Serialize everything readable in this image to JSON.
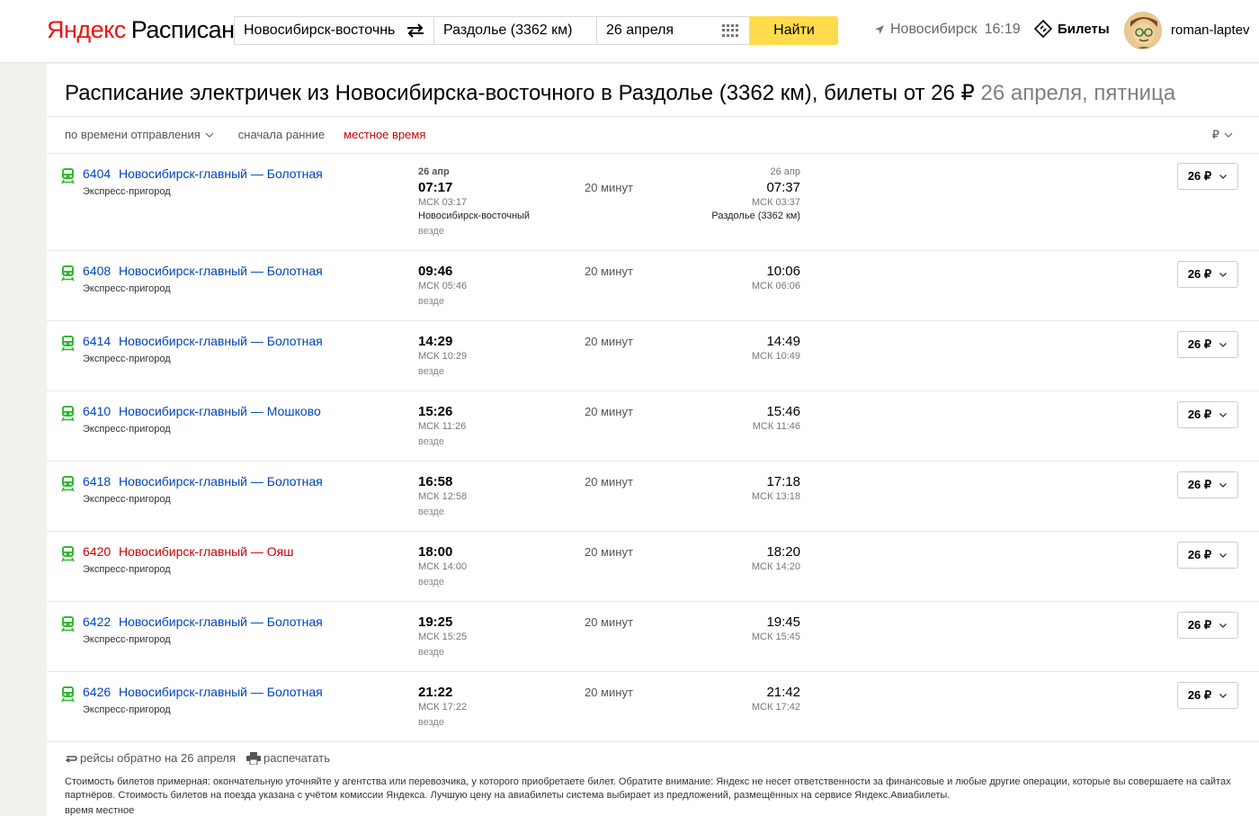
{
  "header": {
    "logo_brand": "Яндекс",
    "logo_service": "Расписания",
    "from_value": "Новосибирск-восточнь",
    "to_value": "Раздолье (3362 км)",
    "date_value": "26 апреля",
    "find_label": "Найти",
    "city": "Новосибирск",
    "local_time": "16:19",
    "tickets_label": "Билеты",
    "username": "roman-laptev"
  },
  "page": {
    "title_main": "Расписание электричек из Новосибирска-восточного в Раздолье (3362 км), билеты от 26 ₽",
    "title_date": "26 апреля, пятница"
  },
  "sort": {
    "by_departure": "по времени отправления",
    "early_first": "сначала ранние",
    "local_time": "местное время",
    "currency": "₽"
  },
  "trains": [
    {
      "number": "6404",
      "route": "Новосибирск-главный — Болотная",
      "type": "Экспресс-пригород",
      "dep_date": "26 апр",
      "dep_time": "07:17",
      "dep_msk": "МСК 03:17",
      "dep_station": "Новосибирск-восточный",
      "days": "везде",
      "duration": "20 минут",
      "arr_date": "26 апр",
      "arr_time": "07:37",
      "arr_msk": "МСК 03:37",
      "arr_station": "Раздолье (3362 км)",
      "price": "26 ₽",
      "highlight": false
    },
    {
      "number": "6408",
      "route": "Новосибирск-главный — Болотная",
      "type": "Экспресс-пригород",
      "dep_time": "09:46",
      "dep_msk": "МСК 05:46",
      "days": "везде",
      "duration": "20 минут",
      "arr_time": "10:06",
      "arr_msk": "МСК 06:06",
      "price": "26 ₽",
      "highlight": false
    },
    {
      "number": "6414",
      "route": "Новосибирск-главный — Болотная",
      "type": "Экспресс-пригород",
      "dep_time": "14:29",
      "dep_msk": "МСК 10:29",
      "days": "везде",
      "duration": "20 минут",
      "arr_time": "14:49",
      "arr_msk": "МСК 10:49",
      "price": "26 ₽",
      "highlight": false
    },
    {
      "number": "6410",
      "route": "Новосибирск-главный — Мошково",
      "type": "Экспресс-пригород",
      "dep_time": "15:26",
      "dep_msk": "МСК 11:26",
      "days": "везде",
      "duration": "20 минут",
      "arr_time": "15:46",
      "arr_msk": "МСК 11:46",
      "price": "26 ₽",
      "highlight": false
    },
    {
      "number": "6418",
      "route": "Новосибирск-главный — Болотная",
      "type": "Экспресс-пригород",
      "dep_time": "16:58",
      "dep_msk": "МСК 12:58",
      "days": "везде",
      "duration": "20 минут",
      "arr_time": "17:18",
      "arr_msk": "МСК 13:18",
      "price": "26 ₽",
      "highlight": false
    },
    {
      "number": "6420",
      "route": "Новосибирск-главный — Ояш",
      "type": "Экспресс-пригород",
      "dep_time": "18:00",
      "dep_msk": "МСК 14:00",
      "days": "везде",
      "duration": "20 минут",
      "arr_time": "18:20",
      "arr_msk": "МСК 14:20",
      "price": "26 ₽",
      "highlight": true
    },
    {
      "number": "6422",
      "route": "Новосибирск-главный — Болотная",
      "type": "Экспресс-пригород",
      "dep_time": "19:25",
      "dep_msk": "МСК 15:25",
      "days": "везде",
      "duration": "20 минут",
      "arr_time": "19:45",
      "arr_msk": "МСК 15:45",
      "price": "26 ₽",
      "highlight": false
    },
    {
      "number": "6426",
      "route": "Новосибирск-главный — Болотная",
      "type": "Экспресс-пригород",
      "dep_time": "21:22",
      "dep_msk": "МСК 17:22",
      "days": "везде",
      "duration": "20 минут",
      "arr_time": "21:42",
      "arr_msk": "МСК 17:42",
      "price": "26 ₽",
      "highlight": false
    }
  ],
  "footer": {
    "return_link": "рейсы обратно на 26 апреля",
    "print_link": "распечатать",
    "disclaimer": "Стоимость билетов примерная: окончательную уточняйте у агентства или перевозчика, у которого приобретаете билет. Обратите внимание: Яндекс не несет ответственности за финансовые и любые другие операции, которые вы совершаете на сайтах партнёров. Стоимость билетов на поезда указана с учётом комиссии Яндекса. Лучшую цену на авиабилеты система выбирает из предложений, размещённых на сервисе Яндекс.Авиабилеты.",
    "time_note": "время местное"
  },
  "colors": {
    "accent_yellow": "#ffdb4d",
    "link_blue": "#0044bb",
    "highlight_red": "#cc0000",
    "train_green": "#33b833"
  },
  "icons": {
    "swap": "swap-arrows-icon",
    "calendar": "calendar-grid-icon",
    "geo": "location-arrow-icon",
    "tickets": "ticket-icon",
    "train": "train-icon",
    "chevron": "chevron-down-icon",
    "return": "return-arrows-icon",
    "print": "printer-icon"
  }
}
